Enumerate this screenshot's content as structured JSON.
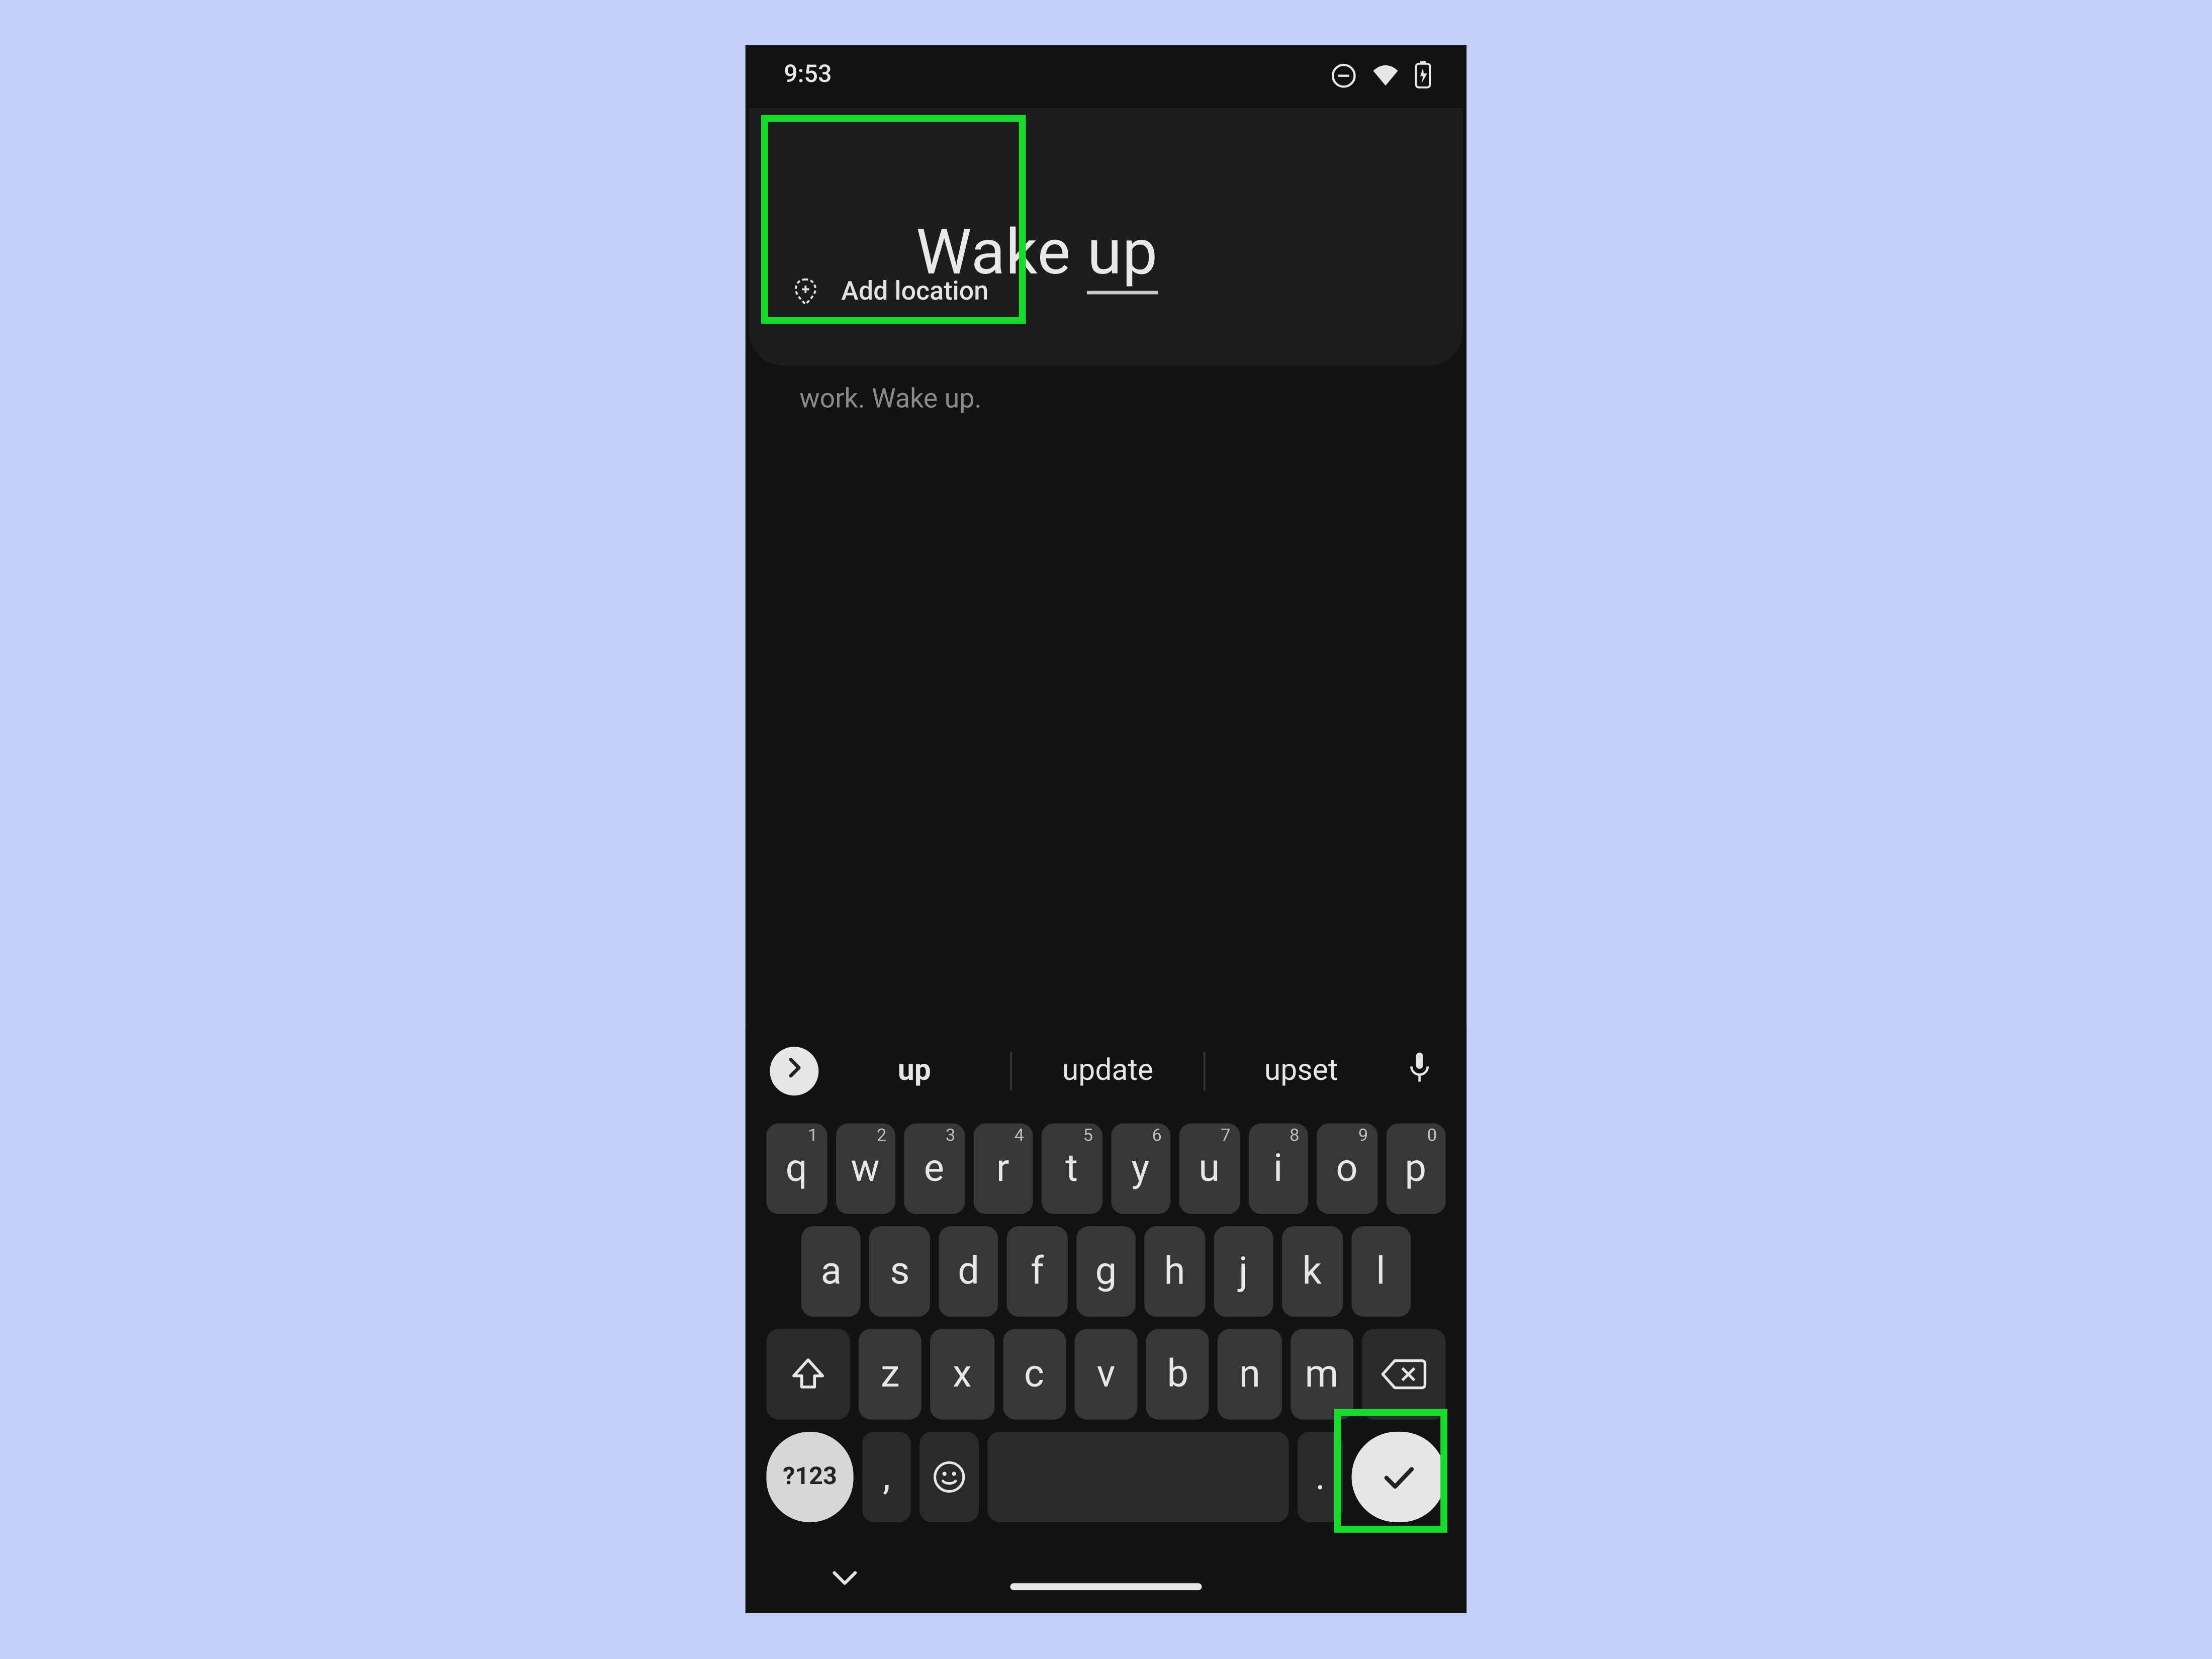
{
  "status": {
    "time": "9:53"
  },
  "header": {
    "title_word1": "Wake ",
    "title_word2": "up",
    "add_location": "Add location"
  },
  "note": {
    "placeholder": "work. Wake up."
  },
  "suggestions": {
    "words": [
      "up",
      "update",
      "upset"
    ]
  },
  "keyboard": {
    "row1_keys": [
      "q",
      "w",
      "e",
      "r",
      "t",
      "y",
      "u",
      "i",
      "o",
      "p"
    ],
    "row1_sup": [
      "1",
      "2",
      "3",
      "4",
      "5",
      "6",
      "7",
      "8",
      "9",
      "0"
    ],
    "row2_keys": [
      "a",
      "s",
      "d",
      "f",
      "g",
      "h",
      "j",
      "k",
      "l"
    ],
    "row3_keys": [
      "z",
      "x",
      "c",
      "v",
      "b",
      "n",
      "m"
    ],
    "sym_label": "?123",
    "comma": ",",
    "period": "."
  }
}
